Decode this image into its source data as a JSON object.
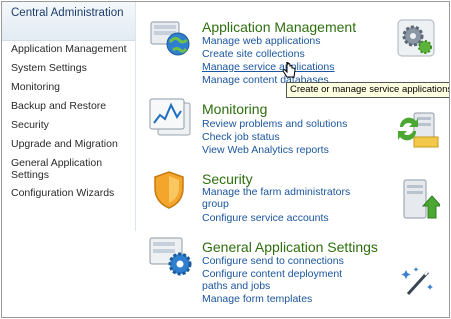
{
  "nav": {
    "header": "Central Administration",
    "items": [
      "Application Management",
      "System Settings",
      "Monitoring",
      "Backup and Restore",
      "Security",
      "Upgrade and Migration",
      "General Application Settings",
      "Configuration Wizards"
    ]
  },
  "sections": {
    "app_management": {
      "title": "Application Management",
      "links": [
        "Manage web applications",
        "Create site collections",
        "Manage service applications",
        "Manage content databases"
      ]
    },
    "monitoring": {
      "title": "Monitoring",
      "links": [
        "Review problems and solutions",
        "Check job status",
        "View Web Analytics reports"
      ]
    },
    "security": {
      "title": "Security",
      "links": [
        "Manage the farm administrators group",
        "Configure service accounts"
      ]
    },
    "general_settings": {
      "title": "General Application Settings",
      "links": [
        "Configure send to connections",
        "Configure content deployment paths and jobs",
        "Manage form templates"
      ]
    }
  },
  "tooltip": "Create or manage service applications",
  "icons": {
    "app_management_left": "server-globe-icon",
    "app_management_right": "gears-icon",
    "monitoring_left": "monitor-chart-icon",
    "monitoring_right": "sync-server-icon",
    "security_left": "shield-icon",
    "security_right": "server-upload-icon",
    "general_settings_left": "settings-gear-icon",
    "general_settings_right": "magic-wand-icon"
  },
  "colors": {
    "section_title": "#2e6f0e",
    "link": "#1a559e",
    "nav_header": "#1d3d6b",
    "tooltip_bg": "#ffffe1"
  }
}
